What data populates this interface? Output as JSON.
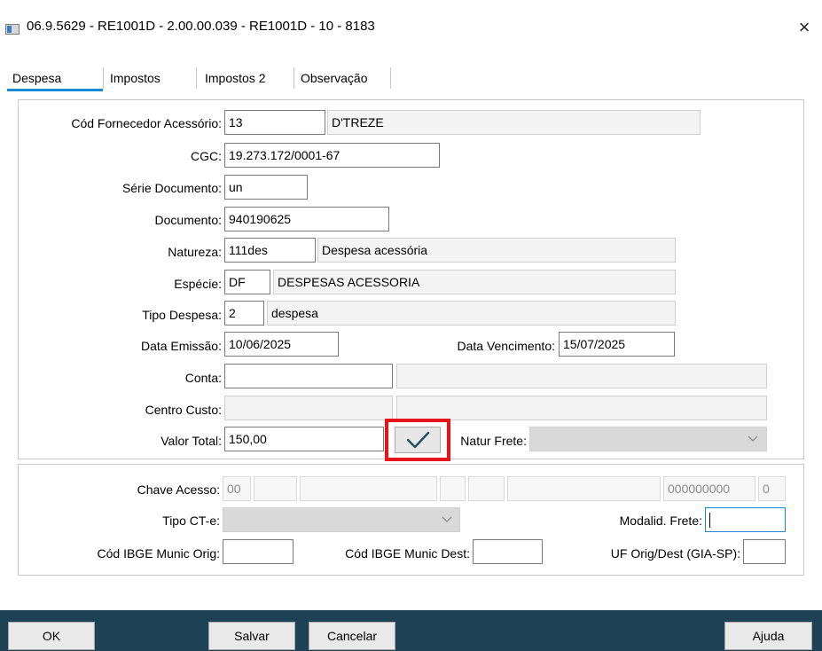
{
  "window": {
    "title": "06.9.5629 - RE1001D - 2.00.00.039 - RE1001D - 10 - 8183",
    "app_icon": "window-app-icon",
    "close_glyph": "×"
  },
  "tabs": [
    {
      "label": "Despesa",
      "active": true
    },
    {
      "label": "Impostos",
      "active": false
    },
    {
      "label": "Impostos 2",
      "active": false
    },
    {
      "label": "Observação",
      "active": false
    }
  ],
  "despesa": {
    "cod_fornecedor": {
      "label": "Cód Fornecedor Acessório:",
      "code": "13",
      "name": "D'TREZE"
    },
    "cgc": {
      "label": "CGC:",
      "value": "19.273.172/0001-67"
    },
    "serie": {
      "label": "Série Documento:",
      "value": "un"
    },
    "documento": {
      "label": "Documento:",
      "value": "940190625"
    },
    "natureza": {
      "label": "Natureza:",
      "code": "111des",
      "desc": "Despesa acessória"
    },
    "especie": {
      "label": "Espécie:",
      "code": "DF",
      "desc": "DESPESAS ACESSORIA"
    },
    "tipo_despesa": {
      "label": "Tipo Despesa:",
      "code": "2",
      "desc": "despesa"
    },
    "data_emissao": {
      "label": "Data Emissão:",
      "value": "10/06/2025"
    },
    "data_vencimento": {
      "label": "Data Vencimento:",
      "value": "15/07/2025"
    },
    "conta": {
      "label": "Conta:",
      "code": "",
      "desc": ""
    },
    "centro_custo": {
      "label": "Centro Custo:",
      "code": "",
      "desc": ""
    },
    "valor_total": {
      "label": "Valor Total:",
      "value": "150,00"
    },
    "natur_frete": {
      "label": "Natur Frete:",
      "value": ""
    }
  },
  "cte": {
    "chave_acesso": {
      "label": "Chave Acesso:",
      "parts": [
        "00",
        "",
        "",
        "",
        "",
        "",
        "000000000",
        "0"
      ]
    },
    "tipo_cte": {
      "label": "Tipo CT-e:",
      "value": ""
    },
    "modalid_frete": {
      "label": "Modalid. Frete:",
      "value": ""
    },
    "ibge_orig": {
      "label": "Cód IBGE Munic Orig:",
      "value": ""
    },
    "ibge_dest": {
      "label": "Cód IBGE Munic Dest:",
      "value": ""
    },
    "uf_orig_dest": {
      "label": "UF Orig/Dest (GIA-SP):",
      "value": ""
    }
  },
  "footer": {
    "ok": "OK",
    "salvar": "Salvar",
    "cancelar": "Cancelar",
    "ajuda": "Ajuda"
  },
  "colors": {
    "footer_bg": "#1d4256",
    "active_tab_underline": "#1a8ad4",
    "highlight": "#e8141c",
    "check_icon": "#1f4e63"
  }
}
